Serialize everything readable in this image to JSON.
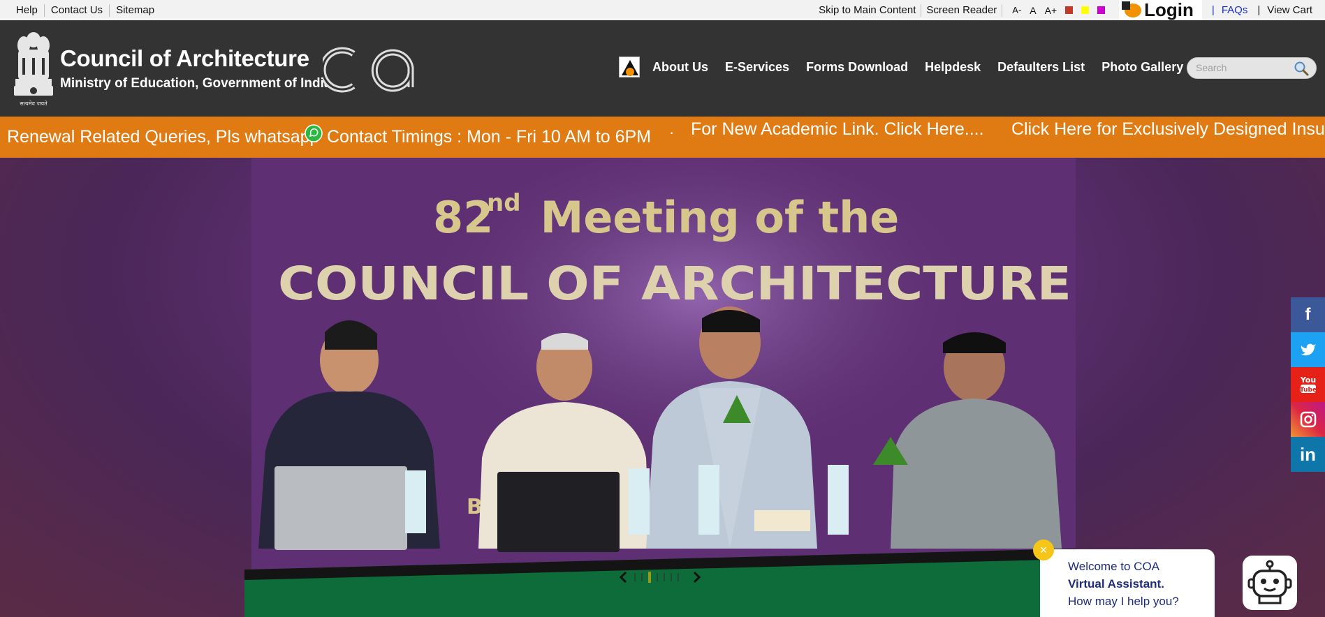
{
  "topbar": {
    "links": [
      "Help",
      "Contact Us",
      "Sitemap"
    ],
    "skip": "Skip to Main Content",
    "screen_reader": "Screen Reader",
    "font_small": "A-",
    "font_normal": "A",
    "font_large": "A+",
    "theme_colors": [
      "#c0392b",
      "#ffff00",
      "#cc00cc"
    ],
    "login": "Login",
    "faqs": "FAQs",
    "cart": "View Cart"
  },
  "header": {
    "title": "Council of Architecture",
    "subtitle": "Ministry of Education, Government of India",
    "emblem_caption": "सत्यमेव जयते",
    "logo_text": "CA",
    "nav": [
      "About Us",
      "E-Services",
      "Forms Download",
      "Helpdesk",
      "Defaulters List",
      "Photo Gallery"
    ],
    "search_placeholder": "Search"
  },
  "ticker": {
    "t1": "Renewal Related Queries, Pls whatsapp",
    "t2": "Contact Timings : Mon - Fri 10 AM to 6PM",
    "sep": "·",
    "t3": "For New Academic Link. Click Here....",
    "t4": "Click Here for Exclusively Designed Insuran"
  },
  "hero": {
    "line1_num": "82",
    "line1_sup": "nd",
    "line1_rest": " Meeting of the",
    "line2": "COUNCIL OF ARCHITECTURE",
    "partial": "Ba"
  },
  "slider": {
    "prev": "‹",
    "next": "›",
    "active_index": 2,
    "count": 7
  },
  "social": [
    "f",
    "twitter",
    "You Tube",
    "instagram",
    "in"
  ],
  "chat": {
    "line1": "Welcome to COA",
    "line2": "Virtual Assistant.",
    "line3": "How may I help you?",
    "close": "×"
  },
  "colors": {
    "orange": "#e07b14",
    "header": "#333333",
    "facebook": "#3b5998",
    "twitter": "#1da1f2",
    "youtube": "#e62117",
    "instagram": "#c13584",
    "linkedin": "#0e76a8"
  }
}
